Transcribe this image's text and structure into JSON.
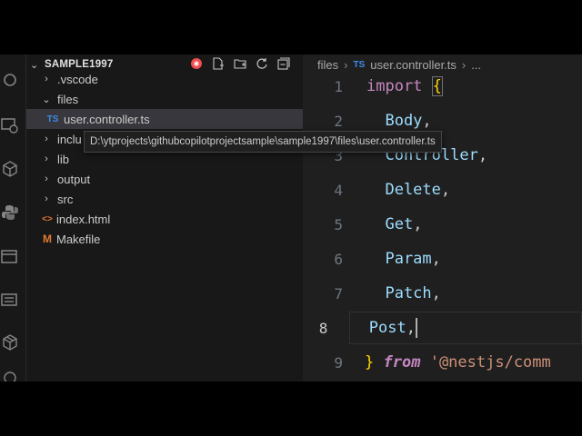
{
  "explorer": {
    "root": "SAMPLE1997",
    "items": [
      {
        "label": ".vscode",
        "kind": "folder",
        "state": "collapsed"
      },
      {
        "label": "files",
        "kind": "folder",
        "state": "expanded"
      },
      {
        "label": "user.controller.ts",
        "kind": "ts",
        "state": "file",
        "badge": "TS"
      },
      {
        "label": "inclu",
        "kind": "folder",
        "state": "collapsed"
      },
      {
        "label": "lib",
        "kind": "folder",
        "state": "collapsed"
      },
      {
        "label": "output",
        "kind": "folder",
        "state": "collapsed"
      },
      {
        "label": "src",
        "kind": "folder",
        "state": "collapsed"
      },
      {
        "label": "index.html",
        "kind": "html",
        "state": "file",
        "badge": "<>"
      },
      {
        "label": "Makefile",
        "kind": "make",
        "state": "file",
        "badge": "M"
      }
    ],
    "tooltip": "D:\\ytprojects\\githubcopilotprojectsample\\sample1997\\files\\user.controller.ts"
  },
  "breadcrumb": {
    "folder": "files",
    "badge": "TS",
    "file": "user.controller.ts",
    "more": "..."
  },
  "editor": {
    "lines": [
      {
        "n": "1",
        "parts": [
          {
            "t": "import",
            "c": "kw"
          },
          {
            "t": " ",
            "c": "punct"
          },
          {
            "t": "{",
            "c": "brace"
          }
        ]
      },
      {
        "n": "2",
        "parts": [
          {
            "t": "  Body",
            "c": "ident"
          },
          {
            "t": ",",
            "c": "punct"
          }
        ]
      },
      {
        "n": "3",
        "parts": [
          {
            "t": "  Controller",
            "c": "ident"
          },
          {
            "t": ",",
            "c": "punct"
          }
        ]
      },
      {
        "n": "4",
        "parts": [
          {
            "t": "  Delete",
            "c": "ident"
          },
          {
            "t": ",",
            "c": "punct"
          }
        ]
      },
      {
        "n": "5",
        "parts": [
          {
            "t": "  Get",
            "c": "ident"
          },
          {
            "t": ",",
            "c": "punct"
          }
        ]
      },
      {
        "n": "6",
        "parts": [
          {
            "t": "  Param",
            "c": "ident"
          },
          {
            "t": ",",
            "c": "punct"
          }
        ]
      },
      {
        "n": "7",
        "parts": [
          {
            "t": "  Patch",
            "c": "ident"
          },
          {
            "t": ",",
            "c": "punct"
          }
        ]
      },
      {
        "n": "8",
        "parts": [
          {
            "t": "  Post",
            "c": "ident"
          },
          {
            "t": ",",
            "c": "punct"
          }
        ],
        "current": true
      },
      {
        "n": "9",
        "parts": [
          {
            "t": "}",
            "c": "brace"
          },
          {
            "t": " ",
            "c": "punct"
          },
          {
            "t": "from",
            "c": "kwi"
          },
          {
            "t": " ",
            "c": "punct"
          },
          {
            "t": "'@nestjs/comm",
            "c": "str"
          }
        ]
      }
    ]
  },
  "colors": {
    "ts_badge": "#3b8eea",
    "html_badge": "#e37933",
    "make_badge": "#e37933",
    "keyword": "#c586c0",
    "identifier": "#9cdcfe",
    "string": "#ce9178",
    "brace": "#ffd700"
  }
}
